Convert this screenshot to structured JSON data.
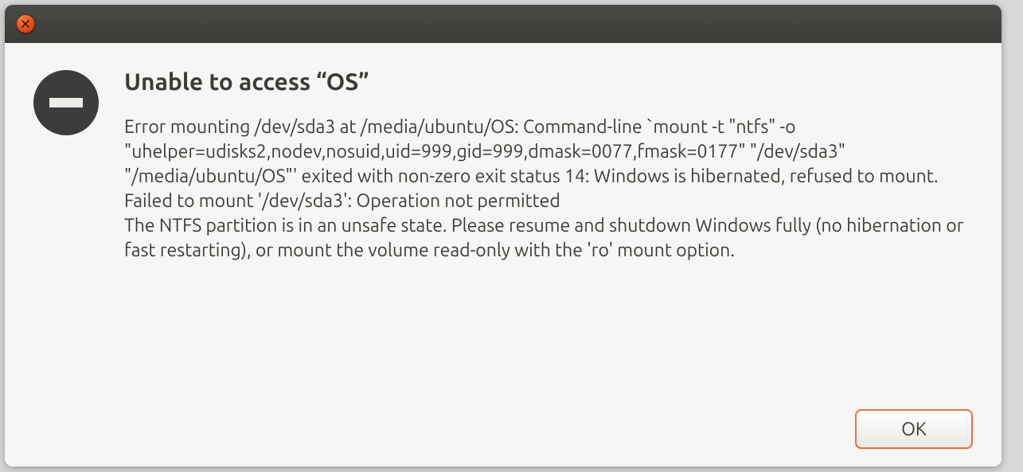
{
  "dialog": {
    "title": "Unable to access “OS”",
    "message": "Error mounting /dev/sda3 at /media/ubuntu/OS: Command-line `mount -t \"ntfs\" -o \"uhelper=udisks2,nodev,nosuid,uid=999,gid=999,dmask=0077,fmask=0177\" \"/dev/sda3\" \"/media/ubuntu/OS\"' exited with non-zero exit status 14: Windows is hibernated, refused to mount.\nFailed to mount '/dev/sda3': Operation not permitted\nThe NTFS partition is in an unsafe state. Please resume and shutdown Windows fully (no hibernation or fast restarting), or mount the volume read-only with the 'ro' mount option.",
    "ok_label": "OK"
  },
  "icons": {
    "error": "minus-circle-icon",
    "close": "close-icon"
  },
  "colors": {
    "accent": "#e9713a",
    "titlebar": "#3c3b37",
    "dialog_bg": "#f7f6f5",
    "text": "#3c3b37"
  }
}
